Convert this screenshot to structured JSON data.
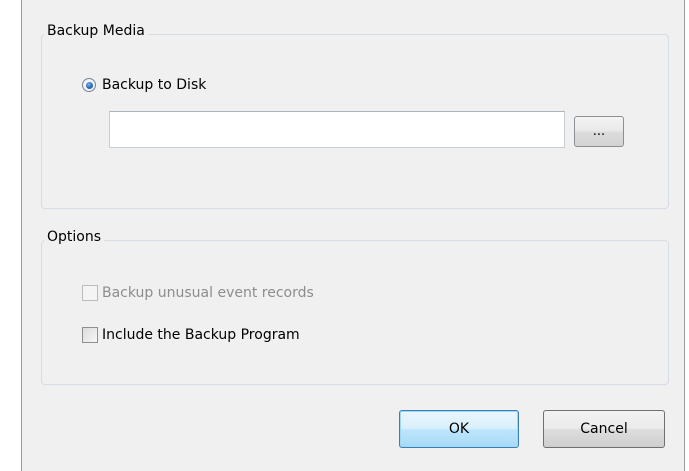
{
  "backup_media": {
    "title": "Backup Media",
    "radio_label": "Backup to Disk",
    "radio_selected": true,
    "path_value": "",
    "browse_label": "..."
  },
  "options": {
    "title": "Options",
    "unusual_label": "Backup unusual event records",
    "unusual_checked": false,
    "unusual_enabled": false,
    "program_label": "Include the Backup Program",
    "program_checked": false
  },
  "buttons": {
    "ok": "OK",
    "cancel": "Cancel"
  },
  "colors": {
    "dialog_bg": "#f0f0f0",
    "group_border": "#d6dde4",
    "default_button_border": "#3c7fb1",
    "disabled_text": "#8d8d8d"
  }
}
